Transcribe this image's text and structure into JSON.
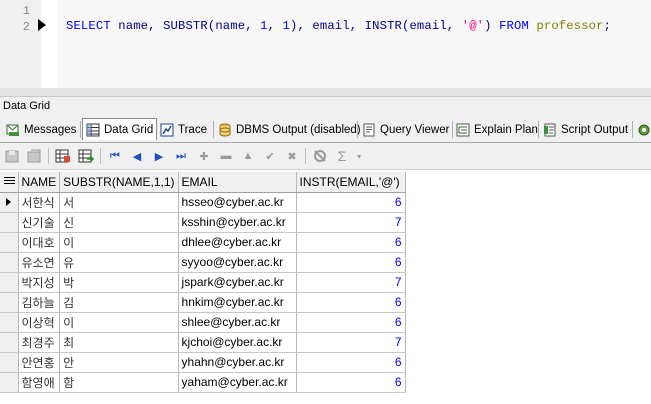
{
  "editor": {
    "line_numbers": [
      "1",
      "2"
    ],
    "sql_tokens": [
      {
        "t": "SELECT",
        "c": "kw"
      },
      {
        "t": " ",
        "c": ""
      },
      {
        "t": "name",
        "c": "id"
      },
      {
        "t": ", ",
        "c": "id"
      },
      {
        "t": "SUBSTR",
        "c": "id"
      },
      {
        "t": "(",
        "c": "id"
      },
      {
        "t": "name",
        "c": "id"
      },
      {
        "t": ", ",
        "c": "id"
      },
      {
        "t": "1",
        "c": "num"
      },
      {
        "t": ", ",
        "c": "id"
      },
      {
        "t": "1",
        "c": "num"
      },
      {
        "t": "), ",
        "c": "id"
      },
      {
        "t": "email",
        "c": "id"
      },
      {
        "t": ", ",
        "c": "id"
      },
      {
        "t": "INSTR",
        "c": "id"
      },
      {
        "t": "(",
        "c": "id"
      },
      {
        "t": "email",
        "c": "id"
      },
      {
        "t": ", ",
        "c": "id"
      },
      {
        "t": "'@'",
        "c": "str"
      },
      {
        "t": ") ",
        "c": "id"
      },
      {
        "t": "FROM",
        "c": "kw"
      },
      {
        "t": " ",
        "c": ""
      },
      {
        "t": "professor",
        "c": "tbl"
      },
      {
        "t": ";",
        "c": "id"
      }
    ]
  },
  "panel": {
    "title": "Data Grid"
  },
  "tabs": [
    {
      "label": "Messages",
      "icon": "messages-icon",
      "active": false
    },
    {
      "label": "Data Grid",
      "icon": "grid-icon",
      "active": true
    },
    {
      "label": "Trace",
      "icon": "trace-icon",
      "active": false
    },
    {
      "label": "DBMS Output (disabled)",
      "icon": "dbms-output-icon",
      "active": false
    },
    {
      "label": "Query Viewer",
      "icon": "query-viewer-icon",
      "active": false
    },
    {
      "label": "Explain Plan",
      "icon": "explain-plan-icon",
      "active": false
    },
    {
      "label": "Script Output",
      "icon": "script-output-icon",
      "active": false
    }
  ],
  "toolbar": {
    "nav_first": "⏮",
    "nav_prev": "◀",
    "nav_next": "▶",
    "nav_last": "⏭",
    "add": "✚",
    "remove": "▬",
    "up": "▲",
    "post": "✔",
    "cancel": "✖",
    "sum": "Σ"
  },
  "grid": {
    "columns": [
      "NAME",
      "SUBSTR(NAME,1,1)",
      "EMAIL",
      "INSTR(EMAIL,'@')"
    ],
    "rows": [
      [
        "서한식",
        "서",
        "hsseo@cyber.ac.kr",
        "6"
      ],
      [
        "신기술",
        "신",
        "ksshin@cyber.ac.kr",
        "7"
      ],
      [
        "이대호",
        "이",
        "dhlee@cyber.ac.kr",
        "6"
      ],
      [
        "유소연",
        "유",
        "syyoo@cyber.ac.kr",
        "6"
      ],
      [
        "박지성",
        "박",
        "jspark@cyber.ac.kr",
        "7"
      ],
      [
        "김하늘",
        "김",
        "hnkim@cyber.ac.kr",
        "6"
      ],
      [
        "이상혁",
        "이",
        "shlee@cyber.ac.kr",
        "6"
      ],
      [
        "최경주",
        "최",
        "kjchoi@cyber.ac.kr",
        "7"
      ],
      [
        "안연홍",
        "안",
        "yhahn@cyber.ac.kr",
        "6"
      ],
      [
        "함영애",
        "함",
        "yaham@cyber.ac.kr",
        "6"
      ]
    ],
    "current_row": 0
  }
}
